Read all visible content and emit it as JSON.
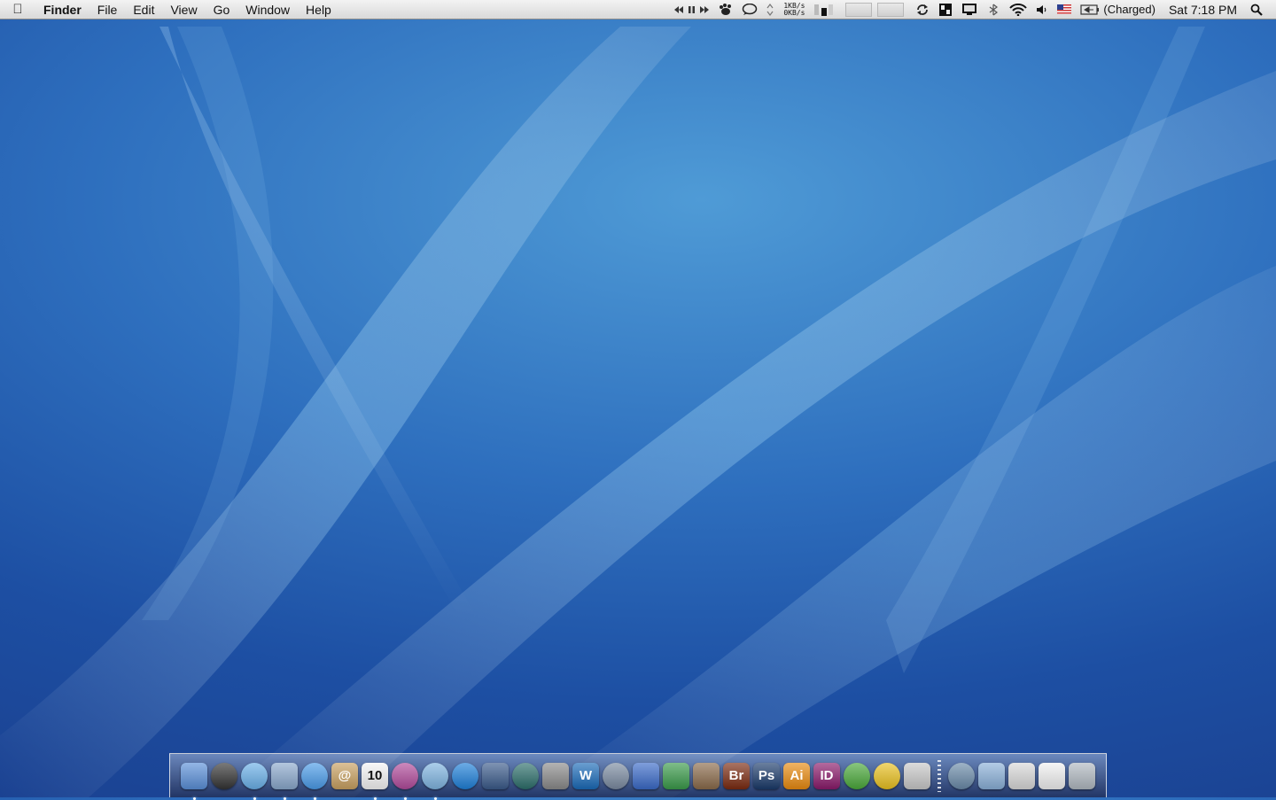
{
  "menubar": {
    "app_name": "Finder",
    "menus": [
      "File",
      "Edit",
      "View",
      "Go",
      "Window",
      "Help"
    ],
    "network": {
      "up": "1KB/s",
      "down": "0KB/s"
    },
    "battery_status": "(Charged)",
    "clock": "Sat 7:18 PM"
  },
  "dock": {
    "apps": [
      {
        "name": "finder-icon",
        "label": "",
        "bg": "#5a8fd8",
        "running": true
      },
      {
        "name": "dashboard-icon",
        "label": "",
        "bg": "#333",
        "running": false,
        "round": true
      },
      {
        "name": "safari-icon",
        "label": "",
        "bg": "#6ab0e8",
        "running": true,
        "round": true
      },
      {
        "name": "mail-icon",
        "label": "",
        "bg": "#8aa8cc",
        "running": true
      },
      {
        "name": "ichat-icon",
        "label": "",
        "bg": "#4a9be8",
        "running": true,
        "round": true
      },
      {
        "name": "address-book-icon",
        "label": "@",
        "bg": "#c8a060",
        "running": false
      },
      {
        "name": "ical-icon",
        "label": "10",
        "bg": "#f4f4f4",
        "fg": "#111",
        "running": true
      },
      {
        "name": "itunes-app-icon",
        "label": "",
        "bg": "#b04a9a",
        "running": true,
        "round": true
      },
      {
        "name": "itunes-icon",
        "label": "",
        "bg": "#7fb4e0",
        "running": true,
        "round": true
      },
      {
        "name": "quicktime-icon",
        "label": "",
        "bg": "#1e7fd8",
        "running": false,
        "round": true
      },
      {
        "name": "spaces-icon",
        "label": "",
        "bg": "#3a5a8a",
        "running": false
      },
      {
        "name": "time-machine-icon",
        "label": "",
        "bg": "#2c6e6a",
        "running": false,
        "round": true
      },
      {
        "name": "system-preferences-icon",
        "label": "",
        "bg": "#8a8a8a",
        "running": false
      },
      {
        "name": "dreamweaver-icon",
        "label": "W",
        "bg": "#1a6ab8",
        "running": false
      },
      {
        "name": "script-editor-icon",
        "label": "",
        "bg": "#7a8aa0",
        "running": false,
        "round": true
      },
      {
        "name": "keynote-icon",
        "label": "",
        "bg": "#3a6ac8",
        "running": false
      },
      {
        "name": "numbers-icon",
        "label": "",
        "bg": "#3a9a4a",
        "running": false
      },
      {
        "name": "iphoto-icon",
        "label": "",
        "bg": "#8a6a4a",
        "running": false
      },
      {
        "name": "bridge-icon",
        "label": "Br",
        "bg": "#7a2a10",
        "running": false
      },
      {
        "name": "photoshop-icon",
        "label": "Ps",
        "bg": "#1a3a6a",
        "running": false
      },
      {
        "name": "illustrator-icon",
        "label": "Ai",
        "bg": "#e88a10",
        "running": false
      },
      {
        "name": "indesign-icon",
        "label": "ID",
        "bg": "#8a1a6a",
        "running": false
      },
      {
        "name": "coda-leaf-icon",
        "label": "",
        "bg": "#4aa83a",
        "running": false,
        "round": true
      },
      {
        "name": "cyberduck-icon",
        "label": "",
        "bg": "#e8c020",
        "running": false,
        "round": true
      },
      {
        "name": "textmate-icon",
        "label": "",
        "bg": "#c8c8c8",
        "running": false
      }
    ],
    "stacks": [
      {
        "name": "network-globe-icon",
        "bg": "#6a8aa8",
        "round": true
      },
      {
        "name": "documents-folder-icon",
        "bg": "#8ab0d8"
      },
      {
        "name": "downloads-folder-icon",
        "bg": "#d8d8d8"
      },
      {
        "name": "file-stack-icon",
        "bg": "#f0f0f0"
      },
      {
        "name": "trash-icon",
        "bg": "#b0b8c0"
      }
    ]
  }
}
